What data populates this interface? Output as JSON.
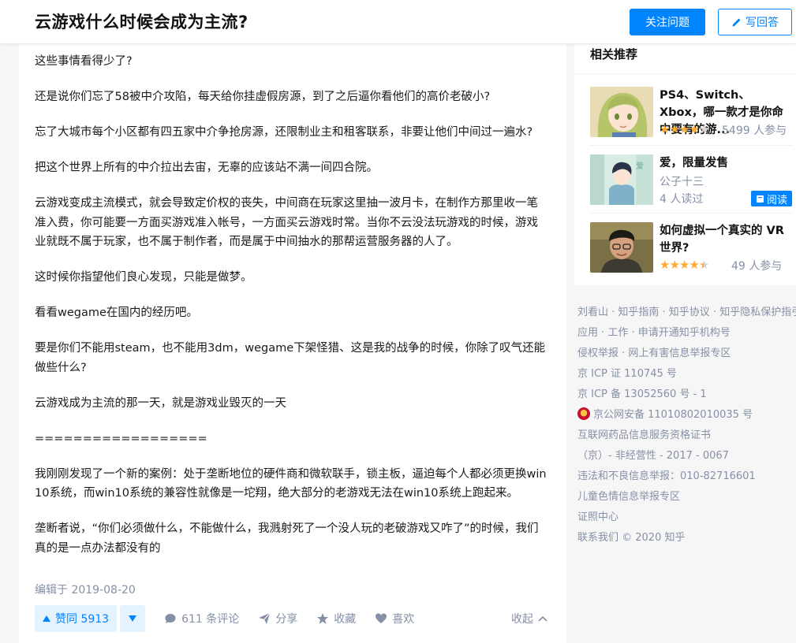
{
  "header": {
    "question_title": "云游戏什么时候会成为主流?",
    "follow_label": "关注问题",
    "answer_label": "写回答"
  },
  "answer": {
    "paragraphs": [
      "这些事情看得少了?",
      "还是说你们忘了58被中介攻陷，每天给你挂虚假房源，到了之后逼你看他们的高价老破小?",
      "忘了大城市每个小区都有四五家中介争抢房源，还限制业主和租客联系，非要让他们中间过一遍水?",
      "把这个世界上所有的中介拉出去宙，无辜的应该站不满一间四合院。",
      "云游戏变成主流模式，就会导致定价权的丧失，中间商在玩家这里抽一波月卡，在制作方那里收一笔准入费，你可能要一方面买游戏准入帐号，一方面买云游戏时常。当你不云没法玩游戏的时候，游戏业就既不属于玩家，也不属于制作者，而是属于中间抽水的那帮运营服务器的人了。",
      "这时候你指望他们良心发现，只能是做梦。",
      "看看wegame在国内的经历吧。",
      "要是你们不能用steam，也不能用3dm，wegame下架怪猎、这是我的战争的时候，你除了叹气还能做些什么?",
      "云游戏成为主流的那一天，就是游戏业毁灭的一天",
      "==================",
      "我刚刚发现了一个新的案例：处于垄断地位的硬件商和微软联手，锁主板，逼迫每个人都必须更换win10系统，而win10系统的兼容性就像是一坨翔，绝大部分的老游戏无法在win10系统上跑起来。",
      "垄断者说，“你们必须做什么，不能做什么，我溅射死了一个没人玩的老破游戏又咋了”的时候，我们真的是一点办法都没有的"
    ],
    "edit_time": "编辑于 2019-08-20",
    "vote_label": "赞同 5913",
    "comments_label": "611 条评论",
    "share_label": "分享",
    "favorite_label": "收藏",
    "like_label": "喜欢",
    "collapse_label": "收起"
  },
  "sidebar": {
    "title": "相关推荐",
    "items": [
      {
        "title": "PS4、Switch、Xbox，哪一款才是你命中要有的游...",
        "rating": 4,
        "count": "5499 人参与",
        "thumb": "anime-girl"
      },
      {
        "title": "爱，限量发售",
        "author": "公子十三",
        "count": "4 人读过",
        "read_label": "阅读",
        "thumb": "anime-boy"
      },
      {
        "title": "如何虚拟一个真实的 VR 世界?",
        "rating": 4.5,
        "count": "49 人参与",
        "thumb": "person-photo"
      }
    ]
  },
  "footer": {
    "lines": [
      "刘看山 · 知乎指南 · 知乎协议 · 知乎隐私保护指引",
      "应用 · 工作 · 申请开通知乎机构号",
      "侵权举报 · 网上有害信息举报专区",
      "京 ICP 证 110745 号",
      "京 ICP 备 13052560 号 - 1",
      "京公网安备 11010802010035 号",
      "互联网药品信息服务资格证书",
      "（京）- 非经营性 - 2017 - 0067",
      "违法和不良信息举报：010-82716601",
      "儿童色情信息举报专区",
      "证照中心",
      "联系我们 © 2020 知乎"
    ]
  },
  "colors": {
    "brand_blue": "#0084ff",
    "muted_text": "#8590a6",
    "star": "#ffab2e"
  }
}
